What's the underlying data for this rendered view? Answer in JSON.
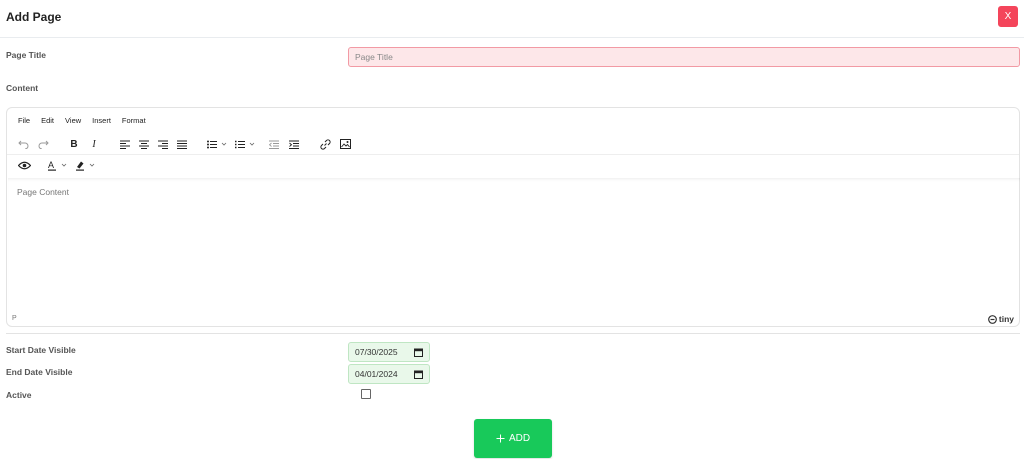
{
  "modal": {
    "title": "Add Page",
    "close_label": "X"
  },
  "form": {
    "page_title_label": "Page Title",
    "page_title_placeholder": "Page Title",
    "content_label": "Content",
    "start_date_label": "Start Date Visible",
    "start_date_value": "07/30/2025",
    "end_date_label": "End Date Visible",
    "end_date_value": "04/01/2024",
    "active_label": "Active",
    "active_checked": false
  },
  "editor": {
    "menu": [
      "File",
      "Edit",
      "View",
      "Insert",
      "Format"
    ],
    "toolbar_icons": [
      "undo-icon",
      "redo-icon",
      "bold-icon",
      "italic-icon",
      "align-left-icon",
      "align-center-icon",
      "align-right-icon",
      "align-justify-icon",
      "bullet-list-icon",
      "numbered-list-icon",
      "outdent-icon",
      "indent-icon",
      "link-icon",
      "image-icon",
      "preview-icon",
      "text-color-icon",
      "highlight-color-icon"
    ],
    "content_placeholder": "Page Content",
    "status_path": "P",
    "brand": "tiny"
  },
  "actions": {
    "add_label": "ADD"
  },
  "colors": {
    "close": "#f4455b",
    "add": "#18c95a",
    "title_invalid_bg": "#fde7e9",
    "date_bg": "#e9f8ea"
  }
}
